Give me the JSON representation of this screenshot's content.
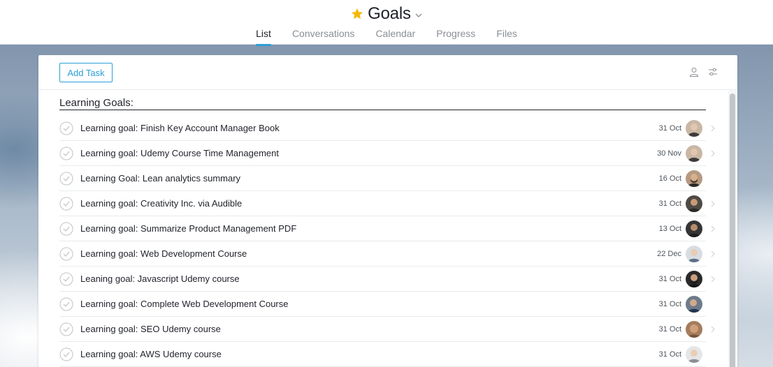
{
  "header": {
    "title": "Goals",
    "star_color": "#f5b800",
    "tabs": [
      {
        "label": "List",
        "active": true
      },
      {
        "label": "Conversations",
        "active": false
      },
      {
        "label": "Calendar",
        "active": false
      },
      {
        "label": "Progress",
        "active": false
      },
      {
        "label": "Files",
        "active": false
      }
    ]
  },
  "toolbar": {
    "add_task_label": "Add Task",
    "icons": [
      "person-icon",
      "filter-icon"
    ]
  },
  "section": {
    "title": "Learning Goals:"
  },
  "tasks": [
    {
      "name": "Learning goal: Finish Key Account Manager Book",
      "date": "31 Oct",
      "avatar": "avatar-1"
    },
    {
      "name": "Learning goal: Udemy Course Time Management",
      "date": "30 Nov",
      "avatar": "avatar-1"
    },
    {
      "name": "Learning Goal: Lean analytics summary",
      "date": "16 Oct",
      "avatar": "avatar-2"
    },
    {
      "name": "Learning goal: Creativity Inc. via Audible",
      "date": "31 Oct",
      "avatar": "avatar-3"
    },
    {
      "name": "Learning goal: Summarize Product Management PDF",
      "date": "13 Oct",
      "avatar": "avatar-4"
    },
    {
      "name": "Learning goal: Web Development Course",
      "date": "22 Dec",
      "avatar": "avatar-5"
    },
    {
      "name": "Leaning goal: Javascript Udemy course",
      "date": "31 Oct",
      "avatar": "avatar-6"
    },
    {
      "name": "Learning goal: Complete Web Development Course",
      "date": "31 Oct",
      "avatar": "avatar-7"
    },
    {
      "name": "Learning goal: SEO Udemy course",
      "date": "31 Oct",
      "avatar": "avatar-8"
    },
    {
      "name": "Learning goal: AWS Udemy course",
      "date": "31 Oct",
      "avatar": "avatar-9"
    }
  ],
  "colors": {
    "accent": "#2a9fd8",
    "text": "#1f2229",
    "muted": "#8a8f96"
  }
}
